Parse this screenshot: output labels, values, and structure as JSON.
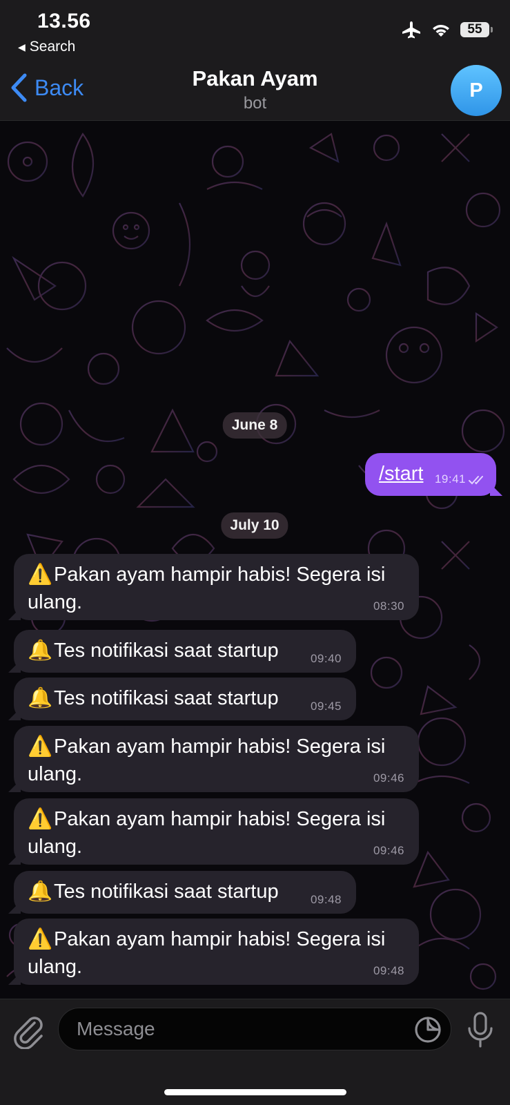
{
  "status_bar": {
    "time": "13.56",
    "back_app_label": "Search",
    "battery_level": "55"
  },
  "header": {
    "back_label": "Back",
    "title": "Pakan Ayam",
    "subtitle": "bot",
    "avatar_initial": "P",
    "avatar_color": "#3ea7f3"
  },
  "chat": {
    "date_1": "June 8",
    "date_2": "July 10",
    "outgoing": {
      "text": "/start",
      "time": "19:41"
    },
    "messages": [
      {
        "emoji": "⚠️",
        "text": "Pakan ayam hampir habis! Segera isi ulang.",
        "time": "08:30"
      },
      {
        "emoji": "🔔",
        "text": "Tes notifikasi saat startup",
        "time": "09:40"
      },
      {
        "emoji": "🔔",
        "text": "Tes notifikasi saat startup",
        "time": "09:45"
      },
      {
        "emoji": "⚠️",
        "text": "Pakan ayam hampir habis! Segera isi ulang.",
        "time": "09:46"
      },
      {
        "emoji": "⚠️",
        "text": "Pakan ayam hampir habis! Segera isi ulang.",
        "time": "09:46"
      },
      {
        "emoji": "🔔",
        "text": "Tes notifikasi saat startup",
        "time": "09:48"
      },
      {
        "emoji": "⚠️",
        "text": "Pakan ayam hampir habis! Segera isi ulang.",
        "time": "09:48"
      }
    ]
  },
  "composer": {
    "placeholder": "Message"
  },
  "colors": {
    "accent": "#3d8bf5",
    "outgoing_bubble": "#9252f0",
    "incoming_bubble": "#26232c"
  },
  "icons": [
    "airplane-icon",
    "wifi-icon",
    "battery-icon",
    "chevron-left-icon",
    "double-check-icon",
    "paperclip-icon",
    "sticker-icon",
    "microphone-icon"
  ]
}
